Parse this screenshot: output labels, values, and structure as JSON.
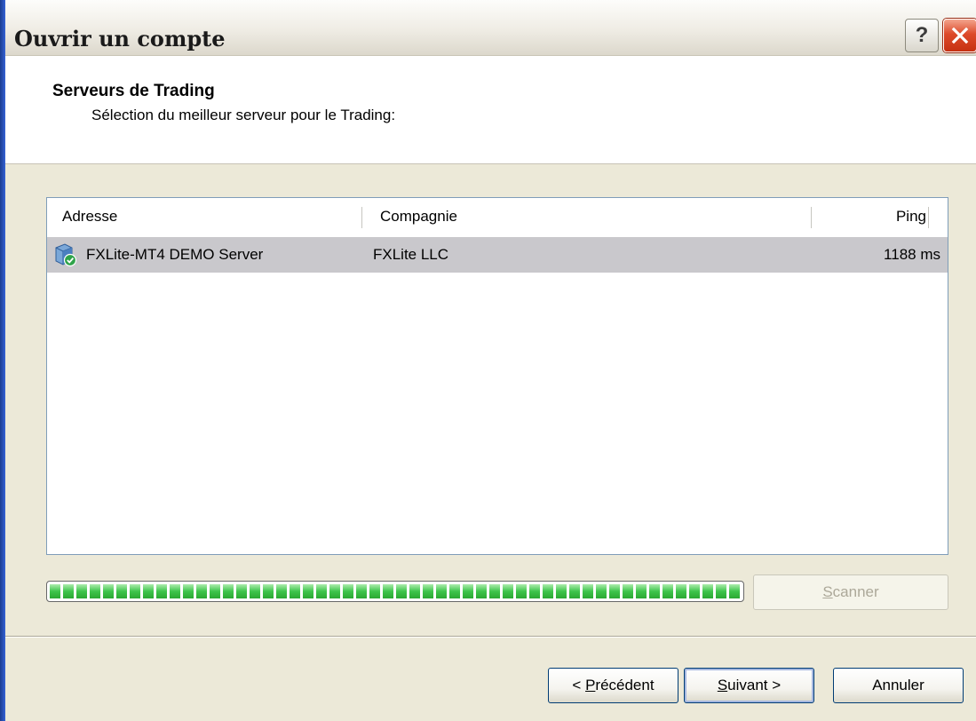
{
  "window": {
    "title": "Ouvrir un compte",
    "help_label": "?"
  },
  "header": {
    "title": "Serveurs de Trading",
    "subtitle": "Sélection du meilleur serveur pour le Trading:"
  },
  "server_list": {
    "columns": {
      "address": "Adresse",
      "company": "Compagnie",
      "ping": "Ping"
    },
    "rows": [
      {
        "address": "FXLite-MT4 DEMO Server",
        "company": "FXLite LLC",
        "ping": "1188 ms",
        "icon": "server-icon"
      }
    ]
  },
  "scan": {
    "progress": 1.0,
    "scan_button": {
      "accel": "S",
      "rest": "canner",
      "enabled": false
    }
  },
  "footer": {
    "back_button": {
      "prefix": "< ",
      "accel": "P",
      "rest": "récédent"
    },
    "next_button": {
      "accel": "S",
      "rest": "uivant >"
    },
    "cancel_button": "Annuler"
  },
  "colors": {
    "selected_row": "#c9c8cc",
    "progress_fill": "#3ec44b",
    "button_border": "#003c74"
  }
}
